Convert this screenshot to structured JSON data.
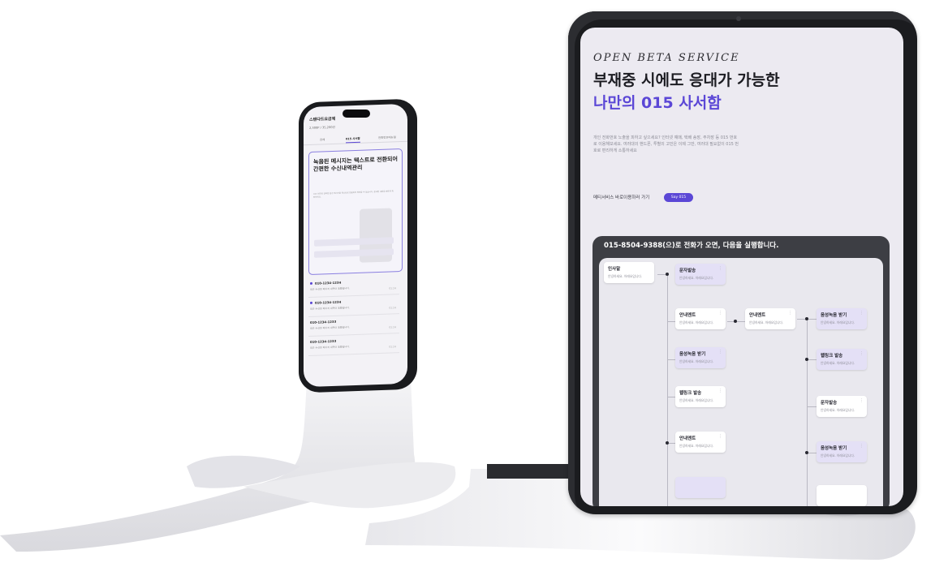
{
  "tablet": {
    "eyebrow": "OPEN BETA SERVICE",
    "headline_1": "부재중 시에도 응대가 가능한",
    "headline_2": "나만의 015 사서함",
    "description": "개인 전화번호 노출을 피하고 싶으세요? 인터넷 예매, 택배 송장, 주차장 등 015 번호로 이용해보세요. 여러대의 핸드폰, 투별의 고민은 이제 그만, 여러대 필요없이 015 번호로 편리하게 소통하세요",
    "link_text": "메티서비스 바로이용하러 가기",
    "cta_button": "Say 015",
    "flow_title": "015-8504-9388(으)로 전화가 오면, 다음을 실행합니다.",
    "node_sub": "안녕하세요. 아래요입니다.",
    "nodes": {
      "greeting": "인사말",
      "sms_send": "문자발송",
      "announce_1": "안내멘트",
      "announce_2": "안내멘트",
      "recv_voice_1": "음성녹음 받기",
      "recv_voice_2": "음성녹음 받기",
      "weblink_1": "웹링크 발송",
      "announce_3": "안내멘트",
      "weblink_2": "웹링크 발송",
      "sms_2": "문자발송",
      "recv_voice_3": "음성녹음 받기"
    }
  },
  "phone": {
    "app_name": "스탠다드요금제",
    "points": "2,300P / 35,200건",
    "tabs": [
      "전체",
      "015 사서함",
      "전화번호메뉴얼"
    ],
    "card_title": "녹음된 메시지는 텍스트로 전환되어 간편한 수신내역관리",
    "card_sub": "015 번호로 걸려온 음성 메시지를 텍스트로 변환하여 확인할 수 있습니다. 중요한 내용을 빠르게 확인하세요.",
    "messages": [
      {
        "number": "010-1234-1234",
        "text": "최근 수신된 메시지 내역이 표출됩니다.",
        "time": "01:24",
        "unread": true
      },
      {
        "number": "010-1234-1234",
        "text": "최근 수신된 메시지 내역이 표출됩니다.",
        "time": "01:24",
        "unread": true
      },
      {
        "number": "010-1234-1233",
        "text": "최근 수신된 메시지 내역이 표출됩니다.",
        "time": "01:24",
        "unread": false
      },
      {
        "number": "010-1234-1233",
        "text": "최근 수신된 메시지 내역이 표출됩니다.",
        "time": "01:24",
        "unread": false
      }
    ]
  },
  "colors": {
    "accent": "#5b47d6",
    "device_frame": "#1b1c1f",
    "paper": "#ededf0"
  }
}
